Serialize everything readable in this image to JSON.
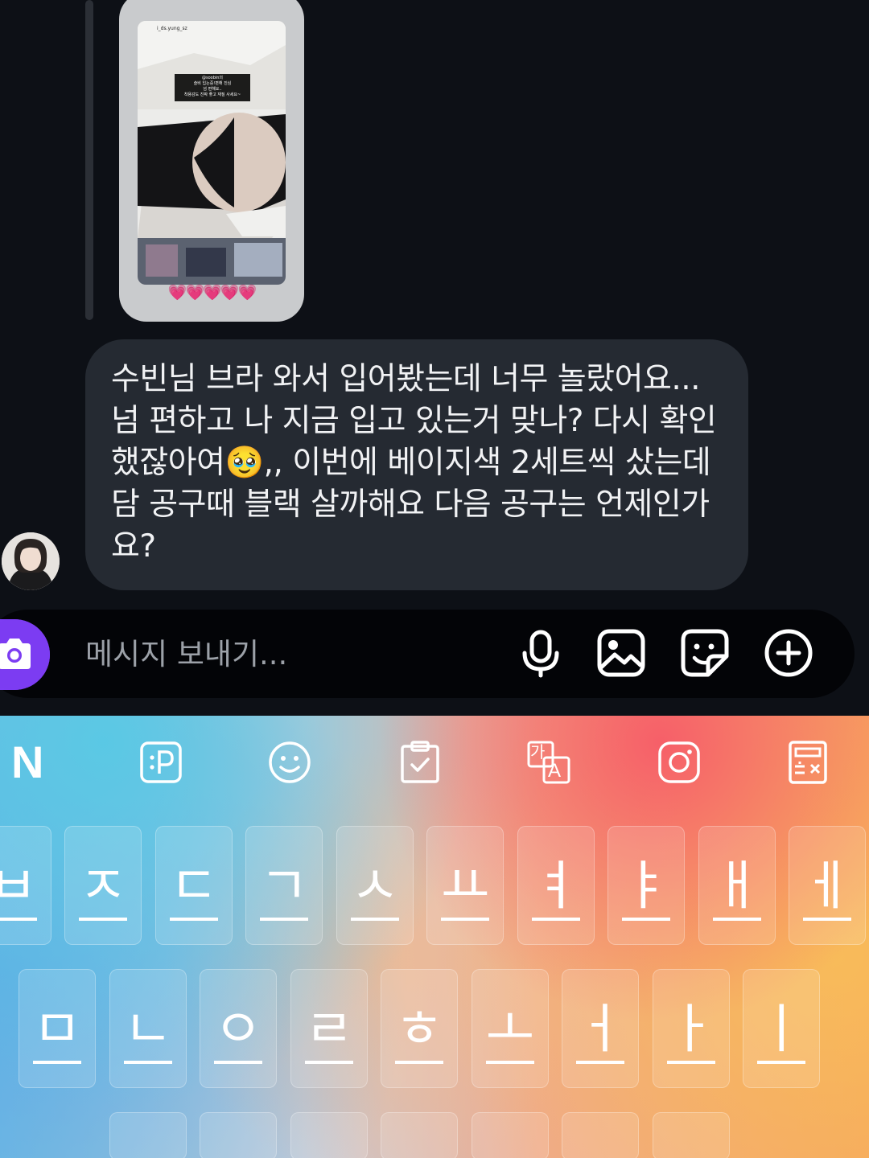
{
  "shared_post": {
    "username": "i_ds.yung_sz",
    "caption_lines": [
      "@soobin의",
      "슬비 입는중!편해 진심",
      "넘 편해요..",
      "착용감도 진짜 좋고 재질 사세요~"
    ],
    "reaction": "💗💗💗💗💗"
  },
  "message": {
    "text": "수빈님 브라 와서 입어봤는데 너무 놀랐어요... 넘 편하고 나 지금 입고 있는거 맞나? 다시 확인했잖아여🥹,, 이번에 베이지색 2세트씩 샀는데 담 공구때 블랙 살까해요 다음 공구는 언제인가요?"
  },
  "composer": {
    "placeholder": "메시지 보내기...",
    "icons": [
      "camera-icon",
      "microphone-icon",
      "image-icon",
      "sticker-icon",
      "plus-circle-icon"
    ],
    "accent_color": "#7c3cf2"
  },
  "keyboard": {
    "logo": "N",
    "toolbar_icons": [
      "emoticon-p-icon",
      "smiley-icon",
      "clipboard-icon",
      "translate-icon",
      "instagram-icon",
      "calculator-icon"
    ],
    "translate_label_top": "가",
    "translate_label_bottom": "A",
    "row1": [
      "ㅂ",
      "ㅈ",
      "ㄷ",
      "ㄱ",
      "ㅅ",
      "ㅛ",
      "ㅕ",
      "ㅑ",
      "ㅐ",
      "ㅔ"
    ],
    "row2": [
      "ㅁ",
      "ㄴ",
      "ㅇ",
      "ㄹ",
      "ㅎ",
      "ㅗ",
      "ㅓ",
      "ㅏ",
      "ㅣ"
    ]
  }
}
